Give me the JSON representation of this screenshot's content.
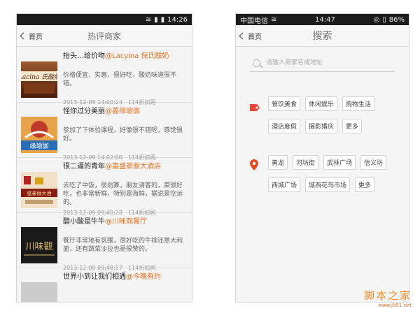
{
  "left": {
    "status": {
      "time": "14:26"
    },
    "nav": {
      "back": "首页",
      "title": "热评商家"
    },
    "items": [
      {
        "title": "抬头…给价吻",
        "mention": "@Lacyina 保氏酸奶",
        "text": "价格便宜，实惠，很好吃，酸奶味道很不错。",
        "time": "2013-12-09 14:00:24",
        "source": "114折扣网",
        "thumb_text": "Lacina 氏酸奶",
        "thumb_color": "#5a2a14"
      },
      {
        "title": "怪你过分美丽",
        "mention": "@善缘瑜伽",
        "text": "参加了下体验课程，好像很不错呢，感觉很好。",
        "time": "2013-12-09 14:02:00",
        "source": "114折扣网",
        "thumb_text": "缘瑜伽",
        "thumb_color": "#2c6fb8"
      },
      {
        "title": "很二逼的青年",
        "mention": "@富盛豪俪大酒店",
        "text": "去吃了中饭，很划算，朋友请客的，菜很好吃，也非常新鲜，特别是海鲜，据说是空运的。",
        "time": "2013-12-09 09:40:28",
        "source": "114折扣网",
        "thumb_text": "盛豪俪大酒",
        "thumb_color": "#8a1d12"
      },
      {
        "title": "醋小酸是牛牛",
        "mention": "@川味观餐厅",
        "text": "餐厅非常地有氛围，很好吃的牛排还意大利面，还有蔬菜沙拉也是很赞的。",
        "time": "2013-12-09 09:48:57",
        "source": "114折扣网",
        "thumb_text": "川味觀",
        "thumb_color": "#1a1a1a"
      },
      {
        "title": "世界小到让我们相遇",
        "mention": "@今晚有约",
        "text": "",
        "time": "",
        "source": "",
        "thumb_text": "",
        "thumb_color": "#cccccc"
      }
    ]
  },
  "right": {
    "status": {
      "carrier": "中国电信",
      "time": "14:47",
      "battery": "86%"
    },
    "nav": {
      "back": "首页",
      "title": "搜索"
    },
    "search": {
      "placeholder": "请输入商家名或地址"
    },
    "categories": [
      "餐饮美食",
      "休闲娱乐",
      "购物生活",
      "酒店度假",
      "摄影婚庆",
      "更多"
    ],
    "areas": [
      "黄龙",
      "河坊街",
      "武林广场",
      "信义坊",
      "西城广场",
      "城西花鸟市场",
      "更多"
    ]
  },
  "watermark": {
    "main": "脚本之家",
    "sub": "www.jb51.net"
  },
  "colors": {
    "accent": "#e8711d",
    "tag_icon": "#e84a3a",
    "pin_icon": "#e8491d"
  }
}
